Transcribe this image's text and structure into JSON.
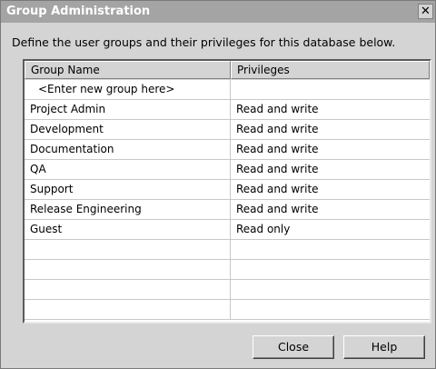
{
  "window": {
    "title": "Group Administration",
    "close_glyph": "✕"
  },
  "instructions": "Define the user groups and their privileges for this database below.",
  "grid": {
    "columns": [
      "Group Name",
      "Privileges"
    ],
    "rows": [
      {
        "group": "<Enter new group here>",
        "privilege": ""
      },
      {
        "group": "Project Admin",
        "privilege": "Read and write"
      },
      {
        "group": "Development",
        "privilege": "Read and write"
      },
      {
        "group": "Documentation",
        "privilege": "Read and write"
      },
      {
        "group": "QA",
        "privilege": "Read and write"
      },
      {
        "group": "Support",
        "privilege": "Read and write"
      },
      {
        "group": "Release Engineering",
        "privilege": "Read and write"
      },
      {
        "group": "Guest",
        "privilege": "Read only"
      },
      {
        "group": "",
        "privilege": ""
      },
      {
        "group": "",
        "privilege": ""
      },
      {
        "group": "",
        "privilege": ""
      },
      {
        "group": "",
        "privilege": ""
      }
    ]
  },
  "buttons": {
    "close_label": "Close",
    "help_label": "Help"
  }
}
